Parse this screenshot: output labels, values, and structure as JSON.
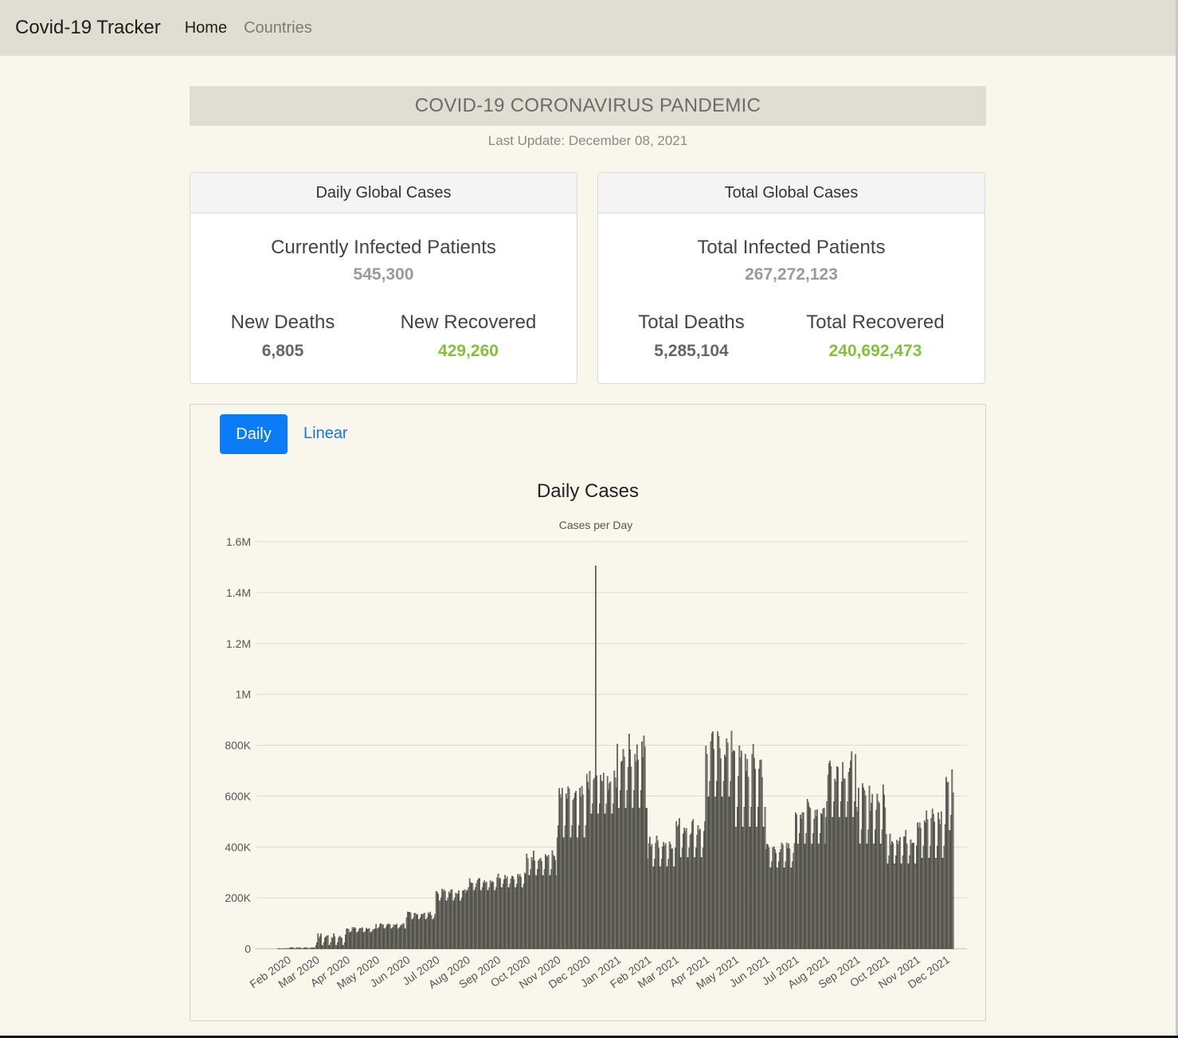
{
  "navbar": {
    "brand": "Covid-19 Tracker",
    "home": "Home",
    "countries": "Countries"
  },
  "banner": {
    "title": "COVID-19 CORONAVIRUS PANDEMIC",
    "last_update": "Last Update: December 08, 2021"
  },
  "daily_card": {
    "header": "Daily Global Cases",
    "main_label": "Currently Infected Patients",
    "main_value": "545,300",
    "deaths_label": "New Deaths",
    "deaths_value": "6,805",
    "recovered_label": "New Recovered",
    "recovered_value": "429,260"
  },
  "total_card": {
    "header": "Total Global Cases",
    "main_label": "Total Infected Patients",
    "main_value": "267,272,123",
    "deaths_label": "Total Deaths",
    "deaths_value": "5,285,104",
    "recovered_label": "Total Recovered",
    "recovered_value": "240,692,473"
  },
  "tabs": {
    "daily": "Daily",
    "linear": "Linear"
  },
  "colors": {
    "accent": "#0a7cf7",
    "recovered": "#84c13a",
    "bar_fill": "#8c8c80",
    "bar_edge": "#1a1a1a"
  },
  "chart_data": {
    "type": "bar",
    "title": "Daily Cases",
    "ylabel": "Cases per Day",
    "xlabel": "",
    "ylim": [
      0,
      1600000
    ],
    "yticks": [
      0,
      200000,
      400000,
      600000,
      800000,
      1000000,
      1200000,
      1400000,
      1600000
    ],
    "ytick_labels": [
      "0",
      "200K",
      "400K",
      "600K",
      "800K",
      "1M",
      "1.2M",
      "1.4M",
      "1.6M"
    ],
    "x_start": "2020-01-22",
    "x_end": "2021-12-08",
    "xtick_labels": [
      "Feb 2020",
      "Mar 2020",
      "Apr 2020",
      "May 2020",
      "Jun 2020",
      "Jul 2020",
      "Aug 2020",
      "Sep 2020",
      "Oct 2020",
      "Nov 2020",
      "Dec 2020",
      "Jan 2021",
      "Feb 2021",
      "Mar 2021",
      "Apr 2021",
      "May 2021",
      "Jun 2021",
      "Jul 2021",
      "Aug 2021",
      "Sep 2021",
      "Oct 2021",
      "Nov 2021",
      "Dec 2021"
    ],
    "grid": true,
    "legend": "none",
    "series": [
      {
        "name": "",
        "spike": {
          "date": "2020-12-10",
          "value": 1505000
        },
        "monthly_peak": {
          "2020-01": 1000,
          "2020-02": 5000,
          "2020-03": 60000,
          "2020-04": 85000,
          "2020-05": 100000,
          "2020-06": 145000,
          "2020-07": 235000,
          "2020-08": 280000,
          "2020-09": 300000,
          "2020-10": 390000,
          "2020-11": 640000,
          "2020-12": 700000,
          "2021-01": 850000,
          "2021-02": 450000,
          "2021-03": 520000,
          "2021-04": 860000,
          "2021-05": 810000,
          "2021-06": 420000,
          "2021-07": 590000,
          "2021-08": 780000,
          "2021-09": 650000,
          "2021-10": 470000,
          "2021-11": 560000,
          "2021-12": 720000
        },
        "monthly_trough": {
          "2020-01": 0,
          "2020-02": 0,
          "2020-03": 5000,
          "2020-04": 60000,
          "2020-05": 75000,
          "2020-06": 110000,
          "2020-07": 180000,
          "2020-08": 220000,
          "2020-09": 230000,
          "2020-10": 270000,
          "2020-11": 400000,
          "2020-12": 500000,
          "2021-01": 500000,
          "2021-02": 300000,
          "2021-03": 330000,
          "2021-04": 550000,
          "2021-05": 420000,
          "2021-06": 300000,
          "2021-07": 380000,
          "2021-08": 470000,
          "2021-09": 370000,
          "2021-10": 310000,
          "2021-11": 320000,
          "2021-12": 420000
        }
      }
    ]
  }
}
